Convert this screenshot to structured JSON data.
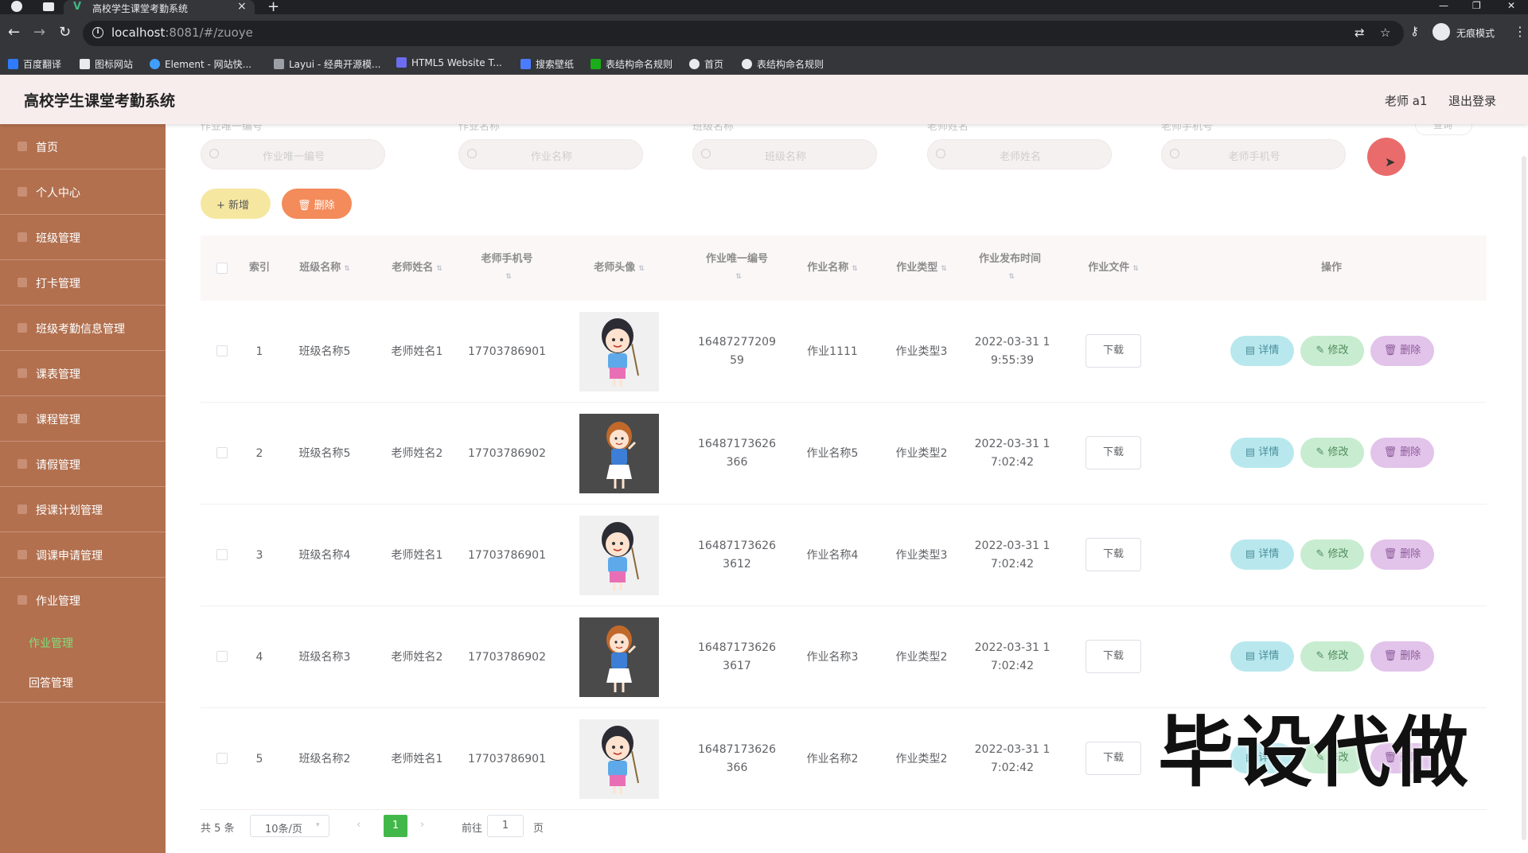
{
  "browser": {
    "tab_title": "高校学生课堂考勤系统",
    "tab_favicon": "V",
    "tab_close": "×",
    "new_tab": "+",
    "url_host": "localhost",
    "url_path": ":8081/#/zuoye",
    "incognito_label": "无痕模式",
    "bookmarks": [
      {
        "label": "百度翻译",
        "color": "#2f7bff"
      },
      {
        "label": "图标网站",
        "color": "#e8eaed"
      },
      {
        "label": "Element - 网站快...",
        "color": "#409eff"
      },
      {
        "label": "Layui - 经典开源模...",
        "color": "#9aa0a6"
      },
      {
        "label": "HTML5 Website T...",
        "color": "#6c6cf0"
      },
      {
        "label": "搜索壁纸",
        "color": "#4a7cff"
      },
      {
        "label": "表结构命名规则",
        "color": "#1aad19"
      },
      {
        "label": "首页",
        "color": "#e8eaed"
      },
      {
        "label": "表结构命名规则",
        "color": "#e8eaed"
      }
    ]
  },
  "header": {
    "title": "高校学生课堂考勤系统",
    "user": "老师 a1",
    "logout": "退出登录"
  },
  "sidebar": {
    "items": [
      {
        "label": "首页"
      },
      {
        "label": "个人中心"
      },
      {
        "label": "班级管理"
      },
      {
        "label": "打卡管理"
      },
      {
        "label": "班级考勤信息管理"
      },
      {
        "label": "课表管理"
      },
      {
        "label": "课程管理"
      },
      {
        "label": "请假管理"
      },
      {
        "label": "授课计划管理"
      },
      {
        "label": "调课申请管理"
      },
      {
        "label": "作业管理"
      }
    ],
    "submenu": [
      {
        "label": "作业管理",
        "active": true
      },
      {
        "label": "回答管理",
        "active": false
      }
    ]
  },
  "search": {
    "fields": [
      {
        "label": "作业唯一编号",
        "placeholder": "作业唯一编号"
      },
      {
        "label": "作业名称",
        "placeholder": "作业名称"
      },
      {
        "label": "班级名称",
        "placeholder": "班级名称"
      },
      {
        "label": "老师姓名",
        "placeholder": "老师姓名"
      },
      {
        "label": "老师手机号",
        "placeholder": "老师手机号"
      }
    ],
    "button": "查询"
  },
  "toolbar": {
    "add": "+ 新增",
    "delete": "🗑 删除"
  },
  "table": {
    "headers": {
      "index": "索引",
      "class_name": "班级名称",
      "teacher_name": "老师姓名",
      "teacher_phone": "老师手机号",
      "teacher_avatar": "老师头像",
      "hw_id": "作业唯一编号",
      "hw_name": "作业名称",
      "hw_type": "作业类型",
      "hw_time": "作业发布时间",
      "hw_file": "作业文件",
      "ops": "操作"
    },
    "rows": [
      {
        "index": "1",
        "class_name": "班级名称5",
        "teacher_name": "老师姓名1",
        "teacher_phone": "17703786901",
        "avatar": "teacher-a",
        "hw_id": "16487277209 59",
        "hw_name": "作业1111",
        "hw_type": "作业类型3",
        "hw_time": "2022-03-31 1 9:55:39"
      },
      {
        "index": "2",
        "class_name": "班级名称5",
        "teacher_name": "老师姓名2",
        "teacher_phone": "17703786902",
        "avatar": "teacher-b",
        "hw_id": "16487173626 366",
        "hw_name": "作业名称5",
        "hw_type": "作业类型2",
        "hw_time": "2022-03-31 1 7:02:42"
      },
      {
        "index": "3",
        "class_name": "班级名称4",
        "teacher_name": "老师姓名1",
        "teacher_phone": "17703786901",
        "avatar": "teacher-a",
        "hw_id": "16487173626 3612",
        "hw_name": "作业名称4",
        "hw_type": "作业类型3",
        "hw_time": "2022-03-31 1 7:02:42"
      },
      {
        "index": "4",
        "class_name": "班级名称3",
        "teacher_name": "老师姓名2",
        "teacher_phone": "17703786902",
        "avatar": "teacher-b",
        "hw_id": "16487173626 3617",
        "hw_name": "作业名称3",
        "hw_type": "作业类型2",
        "hw_time": "2022-03-31 1 7:02:42"
      },
      {
        "index": "5",
        "class_name": "班级名称2",
        "teacher_name": "老师姓名1",
        "teacher_phone": "17703786901",
        "avatar": "teacher-a",
        "hw_id": "16487173626 366",
        "hw_name": "作业名称2",
        "hw_type": "作业类型2",
        "hw_time": "2022-03-31 1 7:02:42"
      }
    ],
    "download_label": "下载",
    "op_labels": {
      "detail": "▤ 详情",
      "edit": "✎ 修改",
      "delete": "🗑 删除"
    }
  },
  "pagination": {
    "total": "共 5 条",
    "page_size": "10条/页",
    "current": "1",
    "goto_label": "前往",
    "goto_value": "1",
    "page_unit": "页"
  },
  "watermark": "毕设代做",
  "colors": {
    "sidebar": "#b2704f",
    "header": "#f7eded",
    "active_submenu": "#7fe07a",
    "page_current": "#43b84a"
  }
}
